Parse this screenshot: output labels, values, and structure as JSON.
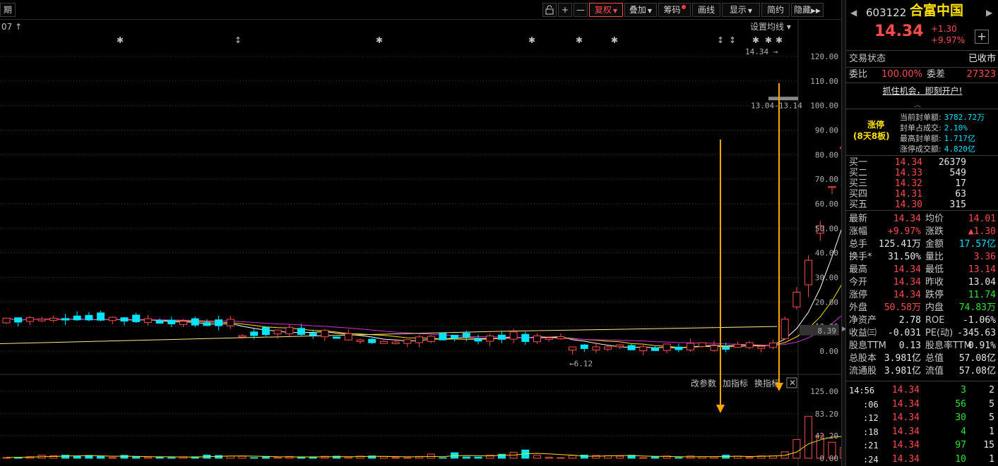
{
  "toolbar": {
    "period_label": "期",
    "unlock_icon": "unlock-icon",
    "zoom_in": "+",
    "zoom_out": "—",
    "fuquan": "复权",
    "diejia": "叠加",
    "chouma": "筹码",
    "huaxian": "画线",
    "xianshi": "显示",
    "jianyue": "简约",
    "yincang": "隐藏"
  },
  "chart": {
    "date_hint": "07",
    "settings_label": "设置均线",
    "price_axis": [
      "120.00",
      "110.00",
      "100.00",
      "90.00",
      "80.00",
      "70.00",
      "60.00",
      "50.00",
      "40.00",
      "30.00",
      "20.00",
      "10.00",
      "0.00"
    ],
    "current_marker": "8.39",
    "high_label": "14.34",
    "open_range_label": "13.04-13.14",
    "low_label": "6.12",
    "volume_axis": [
      "125.00",
      "83.20",
      "42.20",
      "0.00"
    ],
    "vol_buttons": {
      "change": "改参数",
      "add": "加指标",
      "switch": "换指标"
    }
  },
  "chart_data": {
    "type": "candlestick",
    "price_axis_range": [
      0,
      125
    ],
    "volume_axis_range": [
      0,
      125
    ],
    "recent_candles": [
      {
        "open": 5.0,
        "close": 13.0,
        "high": 14.0,
        "low": 4.5
      },
      {
        "open": 18.0,
        "close": 24.0,
        "high": 26.0,
        "low": 17.0
      },
      {
        "open": 27.0,
        "close": 37.0,
        "high": 39.0,
        "low": 22.0
      },
      {
        "open": 48.0,
        "close": 51.0,
        "high": 53.0,
        "low": 45.0
      },
      {
        "open": 67.0,
        "close": 67.0,
        "high": 67.0,
        "low": 64.0
      },
      {
        "open": 83.0,
        "close": 83.0,
        "high": 83.0,
        "low": 80.0
      },
      {
        "open": 120.0,
        "close": 120.0,
        "high": 122.0,
        "low": 101.0
      }
    ],
    "recent_volume": [
      12,
      35,
      78,
      42,
      30,
      20,
      120
    ]
  },
  "stock": {
    "code": "603122",
    "name": "合富中国",
    "price": "14.34",
    "change": "+1.30",
    "change_pct": "+9.97%",
    "status_label": "交易状态",
    "status_value": "已收市",
    "weibi_label": "委比",
    "weibi_value": "100.00%",
    "weicha_label": "委差",
    "weicha_value": "27323",
    "promo": "抓住机会，即刻开户!",
    "limit_title": "涨停",
    "limit_sub": "(8天8板)",
    "limit_rows": [
      {
        "label": "当前封单额:",
        "value": "3782.72万"
      },
      {
        "label": "封单占成交:",
        "value": "2.10%"
      },
      {
        "label": "最高封单额:",
        "value": "1.717亿"
      },
      {
        "label": "涨停成交额:",
        "value": "4.820亿"
      }
    ],
    "bids": [
      {
        "label": "买一",
        "price": "14.34",
        "vol": "26379"
      },
      {
        "label": "买二",
        "price": "14.33",
        "vol": "549"
      },
      {
        "label": "买三",
        "price": "14.32",
        "vol": "17"
      },
      {
        "label": "买四",
        "price": "14.31",
        "vol": "63"
      },
      {
        "label": "买五",
        "price": "14.30",
        "vol": "315"
      }
    ],
    "stats": [
      {
        "l1": "最新",
        "v1": "14.34",
        "c1": "red",
        "l2": "均价",
        "v2": "14.01",
        "c2": "red"
      },
      {
        "l1": "涨幅",
        "v1": "+9.97%",
        "c1": "red",
        "l2": "涨跌",
        "v2": "▲1.30",
        "c2": "red"
      },
      {
        "l1": "总手",
        "v1": "125.41万",
        "c1": "white",
        "l2": "金额",
        "v2": "17.57亿",
        "c2": "cyan"
      },
      {
        "l1": "换手*",
        "v1": "31.50%",
        "c1": "white",
        "l2": "量比",
        "v2": "3.36",
        "c2": "red"
      },
      {
        "l1": "最高",
        "v1": "14.34",
        "c1": "red",
        "l2": "最低",
        "v2": "13.14",
        "c2": "red"
      },
      {
        "l1": "今开",
        "v1": "14.34",
        "c1": "red",
        "l2": "昨收",
        "v2": "13.04",
        "c2": "white"
      },
      {
        "l1": "涨停",
        "v1": "14.34",
        "c1": "red",
        "l2": "跌停",
        "v2": "11.74",
        "c2": "green"
      },
      {
        "l1": "外盘",
        "v1": "50.58万",
        "c1": "red",
        "l2": "内盘",
        "v2": "74.83万",
        "c2": "green"
      },
      {
        "l1": "净资产",
        "v1": "2.78",
        "c1": "white",
        "l2": "ROE",
        "v2": "-1.06%",
        "c2": "white"
      },
      {
        "l1": "收益㈢",
        "v1": "-0.031",
        "c1": "white",
        "l2": "PE(动)",
        "v2": "-345.63",
        "c2": "white"
      },
      {
        "l1": "股息TTM",
        "v1": "0.13",
        "c1": "white",
        "l2": "股息率TTM",
        "v2": "0.91%",
        "c2": "white"
      },
      {
        "l1": "总股本",
        "v1": "3.981亿",
        "c1": "white",
        "l2": "总值",
        "v2": "57.08亿",
        "c2": "white"
      },
      {
        "l1": "流通股",
        "v1": "3.981亿",
        "c1": "white",
        "l2": "流值",
        "v2": "57.08亿",
        "c2": "white"
      }
    ],
    "ticks": [
      {
        "time": "14:56",
        "price": "14.34",
        "vol": "3",
        "cnt": "2"
      },
      {
        "time": ":06",
        "price": "14.34",
        "vol": "56",
        "cnt": "5"
      },
      {
        "time": ":12",
        "price": "14.34",
        "vol": "30",
        "cnt": "5"
      },
      {
        "time": ":18",
        "price": "14.34",
        "vol": "4",
        "cnt": "1"
      },
      {
        "time": ":21",
        "price": "14.34",
        "vol": "97",
        "cnt": "15"
      },
      {
        "time": ":24",
        "price": "14.34",
        "vol": "10",
        "cnt": "1"
      }
    ]
  }
}
